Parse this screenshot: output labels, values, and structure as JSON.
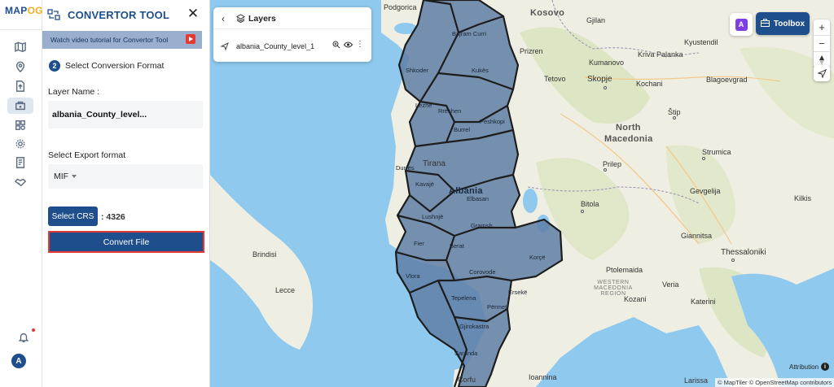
{
  "brand": {
    "logo_left": "MAP",
    "logo_right": "OG"
  },
  "rail": {
    "icons": [
      "map-icon",
      "location-pin-icon",
      "file-upload-icon",
      "data-tools-icon",
      "layers-grid-icon",
      "settings-gear-icon",
      "document-icon",
      "handshake-icon"
    ],
    "active_index": 3
  },
  "panel": {
    "title": "CONVERTOR TOOL",
    "tutorial_link": "Watch video tutorial for Convertor Tool",
    "step_number": "2",
    "step_title": "Select Conversion Format",
    "layer_name_label": "Layer Name :",
    "layer_name_value": "albania_County_level...",
    "export_label": "Select Export format",
    "export_value": "MIF",
    "crs_button": "Select CRS",
    "crs_value": ": 4326",
    "convert_button": "Convert File",
    "avatar_letter": "A"
  },
  "layers_card": {
    "title": "Layers",
    "layer_name": "albania_County_level_1"
  },
  "map_controls": {
    "toolbox_label": "Toolbox",
    "ai_label": "A",
    "zoom_in": "+",
    "zoom_out": "−",
    "attribution": "Attribution",
    "copyright": "© MapTiler © OpenStreetMap contributors"
  },
  "map_labels": {
    "cities": [
      "Podgorica",
      "Kosovo",
      "Gjilan",
      "Prizren",
      "Kumanovo",
      "Kriva Palanka",
      "Kyustendil",
      "Tetovo",
      "Skopje",
      "Kochani",
      "Blagoevgrad",
      "Štip",
      "North",
      "Macedonia",
      "Strumica",
      "Prilep",
      "Gevgelija",
      "Bitola",
      "Kilkis",
      "Giannitsa",
      "Thessaloniki",
      "Ptolemaida",
      "Veria",
      "Kozani",
      "Katerini",
      "Brindisi",
      "Lecce",
      "Larissa",
      "Ioannina",
      "Corfu",
      "Tirana",
      "Albania",
      "Durrës",
      "Shkoder",
      "Kukës",
      "Peshkopi",
      "Burrel",
      "Elbasan",
      "Lushnjë",
      "Fier",
      "Vlora",
      "Berat",
      "Gramsh",
      "Korçë",
      "Corovode",
      "Tepelena",
      "Përmet",
      "Ersekë",
      "Gjirokastra",
      "Saranda",
      "Kavajë",
      "Bajram Curri",
      "Rrëshen",
      "Lezhë"
    ],
    "region": "WESTERN MACEDONIA REGION"
  }
}
